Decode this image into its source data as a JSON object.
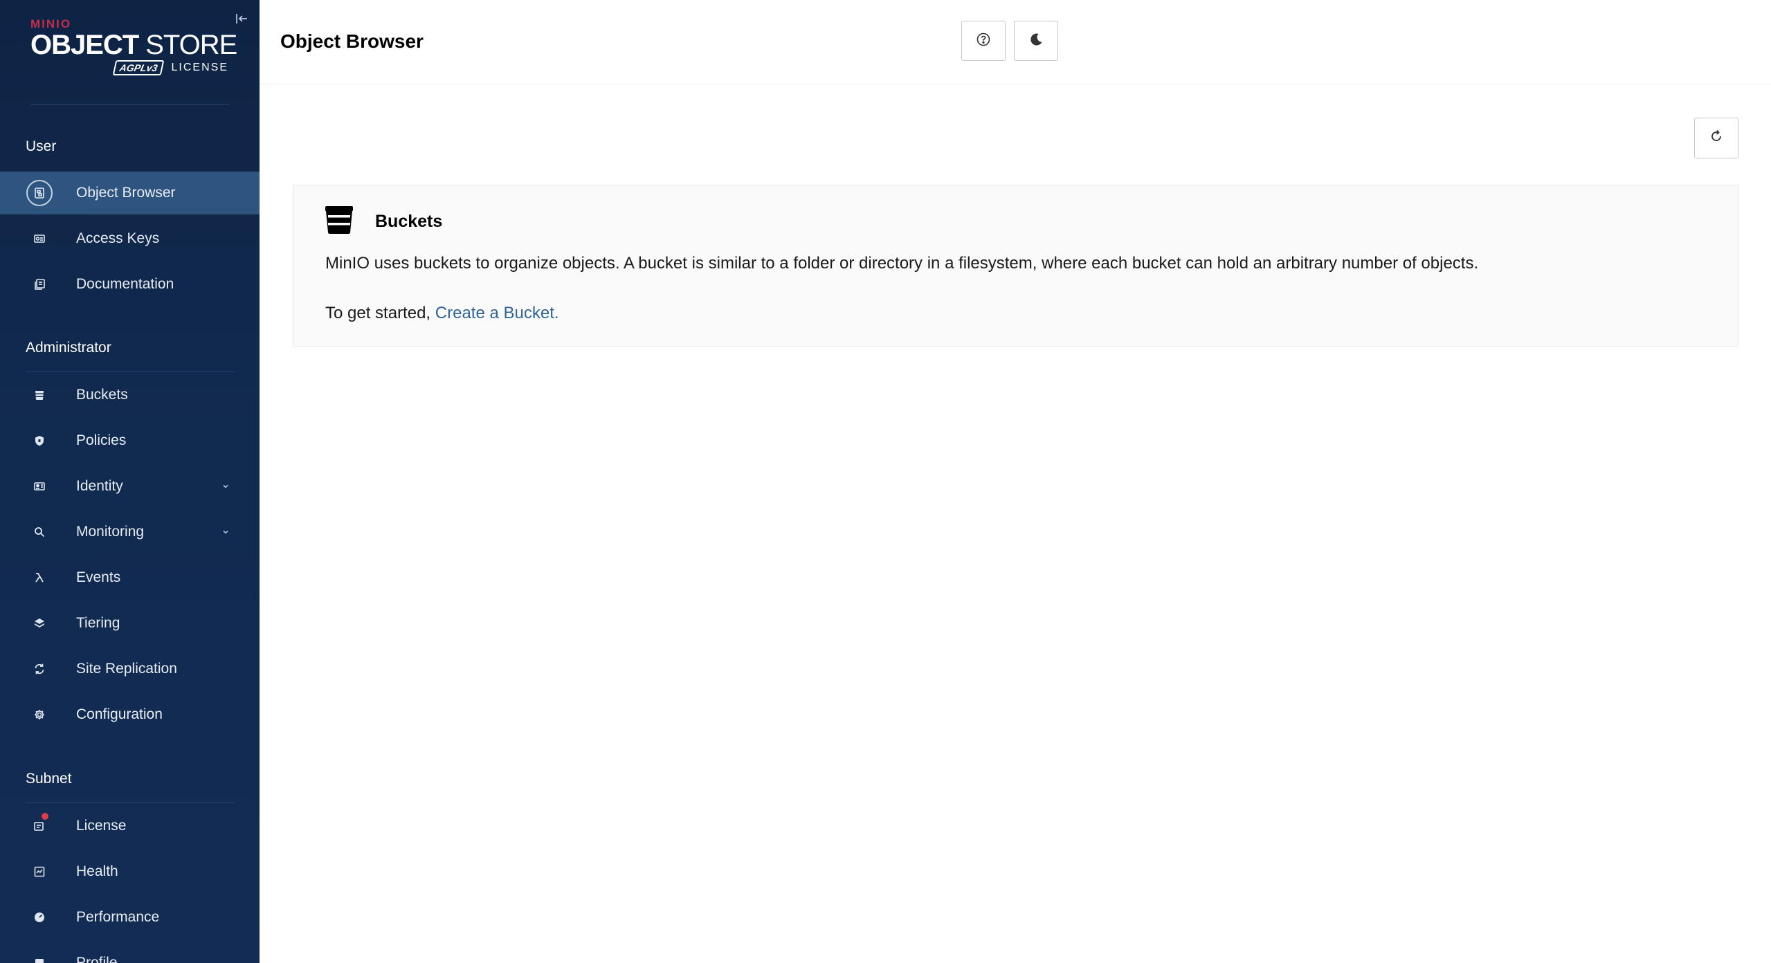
{
  "logo": {
    "brand": "MINIO",
    "product_bold": "OBJECT",
    "product_light": "STORE",
    "agpl": "AGPLv3",
    "license": "LICENSE"
  },
  "sidebar": {
    "sections": [
      {
        "title": "User",
        "items": [
          {
            "label": "Object Browser",
            "icon": "object-browser-icon",
            "active": true
          },
          {
            "label": "Access Keys",
            "icon": "access-keys-icon"
          },
          {
            "label": "Documentation",
            "icon": "documentation-icon"
          }
        ]
      },
      {
        "title": "Administrator",
        "items": [
          {
            "label": "Buckets",
            "icon": "bucket-icon"
          },
          {
            "label": "Policies",
            "icon": "policies-icon"
          },
          {
            "label": "Identity",
            "icon": "identity-icon",
            "expandable": true
          },
          {
            "label": "Monitoring",
            "icon": "monitoring-icon",
            "expandable": true
          },
          {
            "label": "Events",
            "icon": "lambda-icon"
          },
          {
            "label": "Tiering",
            "icon": "tiering-icon"
          },
          {
            "label": "Site Replication",
            "icon": "site-replication-icon"
          },
          {
            "label": "Configuration",
            "icon": "gear-icon"
          }
        ]
      },
      {
        "title": "Subnet",
        "items": [
          {
            "label": "License",
            "icon": "license-icon",
            "notification": true
          },
          {
            "label": "Health",
            "icon": "health-icon"
          },
          {
            "label": "Performance",
            "icon": "performance-icon"
          },
          {
            "label": "Profile",
            "icon": "profile-icon"
          }
        ]
      }
    ]
  },
  "header": {
    "title": "Object Browser",
    "help_icon": "help-icon",
    "theme_icon": "moon-icon"
  },
  "main": {
    "refresh_icon": "refresh-icon",
    "card": {
      "title": "Buckets",
      "description": "MinIO uses buckets to organize objects. A bucket is similar to a folder or directory in a filesystem, where each bucket can hold an arbitrary number of objects.",
      "start_prefix": "To get started, ",
      "create_link": "Create a Bucket."
    }
  },
  "colors": {
    "sidebar_bg": "#112a4f",
    "active_item": "#2e5580",
    "link": "#2f6599",
    "brand_red": "#c72c48"
  }
}
